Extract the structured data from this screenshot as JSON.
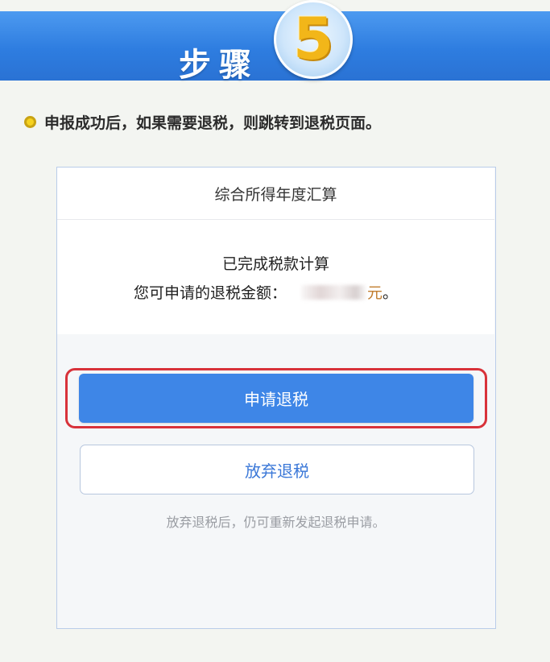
{
  "banner": {
    "title": "步骤",
    "step_number": "5"
  },
  "instruction": {
    "text": "申报成功后，如果需要退税，则跳转到退税页面。"
  },
  "card": {
    "title": "综合所得年度汇算",
    "status": "已完成税款计算",
    "refund_label": "您可申请的退税金额：",
    "refund_unit": "元",
    "refund_period": "。",
    "apply_button": "申请退税",
    "giveup_button": "放弃退税",
    "hint": "放弃退税后，仍可重新发起退税申请。"
  },
  "colors": {
    "banner_blue": "#2e7de0",
    "primary_button": "#3e86e7",
    "highlight_red": "#d8323a",
    "step_gold": "#f2b619",
    "unit_orange": "#c17d2e"
  }
}
